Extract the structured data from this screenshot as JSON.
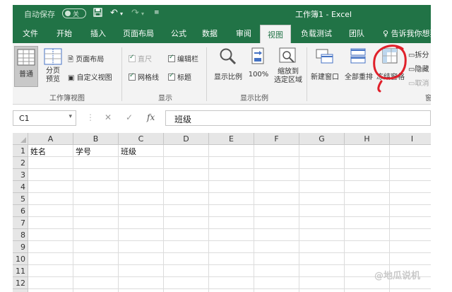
{
  "titlebar": {
    "autosave_label": "自动保存",
    "autosave_state": "关",
    "doc_title": "工作簿1 - Excel",
    "quick_access": [
      "save-icon",
      "undo-icon",
      "redo-icon",
      "customize-icon"
    ]
  },
  "tabs": [
    {
      "label": "文件"
    },
    {
      "label": "开始"
    },
    {
      "label": "插入"
    },
    {
      "label": "页面布局"
    },
    {
      "label": "公式"
    },
    {
      "label": "数据"
    },
    {
      "label": "审阅"
    },
    {
      "label": "视图",
      "active": true
    },
    {
      "label": "负载测试"
    },
    {
      "label": "团队"
    }
  ],
  "tell_me": "告诉我你想要",
  "ribbon": {
    "workbook_views": {
      "group_label": "工作簿视图",
      "normal": "普通",
      "page_break": "分页\n预览",
      "page_layout": "页面布局",
      "custom_views": "自定义视图"
    },
    "show": {
      "group_label": "显示",
      "ruler": "直尺",
      "formula_bar": "编辑栏",
      "gridlines": "网格线",
      "headings": "标题"
    },
    "zoom": {
      "group_label": "显示比例",
      "zoom": "显示比例",
      "zoom_100": "100%",
      "zoom_selection": "缩放到\n选定区域"
    },
    "window": {
      "group_label": "窗",
      "new_window": "新建窗口",
      "arrange_all": "全部重排",
      "freeze_panes": "冻结窗格",
      "split": "拆分",
      "hide": "隐藏",
      "unhide": "取消"
    }
  },
  "formula_bar": {
    "name_box": "C1",
    "cancel_symbol": "✕",
    "enter_symbol": "✓",
    "fx_symbol": "fx",
    "content": "班级"
  },
  "grid": {
    "columns": [
      "A",
      "B",
      "C",
      "D",
      "E",
      "F",
      "G",
      "H",
      "I"
    ],
    "rows": [
      "1",
      "2",
      "3",
      "4",
      "5",
      "6",
      "7",
      "8",
      "9",
      "10",
      "11",
      "12",
      "13"
    ],
    "row1": [
      "姓名",
      "学号",
      "班级"
    ]
  },
  "watermark": "@地瓜说机",
  "colors": {
    "excel_green": "#217346",
    "annotation_red": "#e0202a"
  }
}
